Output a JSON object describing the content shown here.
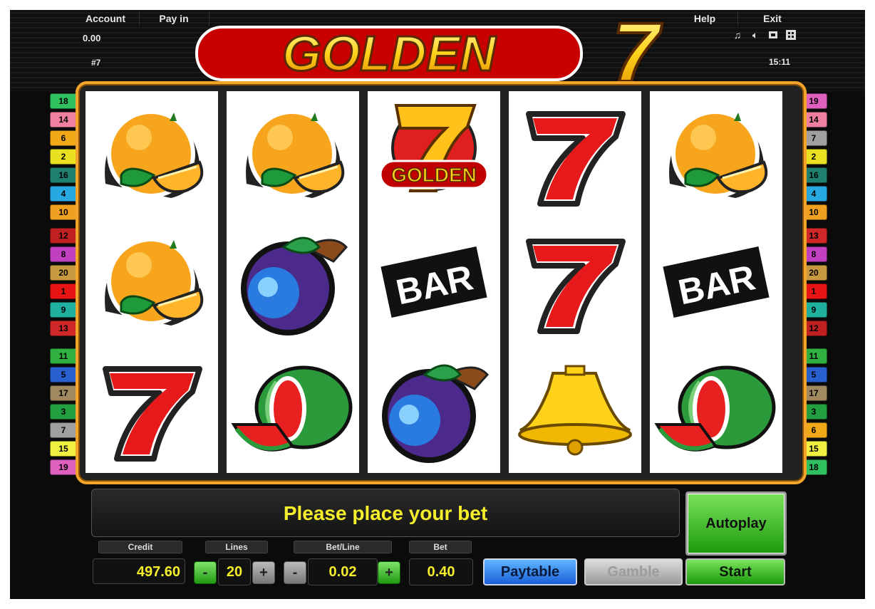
{
  "header": {
    "account_label": "Account",
    "payin_label": "Pay in",
    "help_label": "Help",
    "exit_label": "Exit",
    "account_value": "0.00",
    "session_id": "#7",
    "time": "15:11",
    "icons": [
      "music-icon",
      "sound-icon",
      "fullscreen-icon",
      "settings-icon"
    ]
  },
  "logo": {
    "text": "GOLDEN",
    "seven": "7"
  },
  "paylines": {
    "left": [
      "18",
      "14",
      "6",
      "2",
      "16",
      "4",
      "10",
      "12",
      "8",
      "20",
      "1",
      "9",
      "13",
      "11",
      "5",
      "17",
      "3",
      "7",
      "15",
      "19"
    ],
    "right": [
      "19",
      "14",
      "7",
      "2",
      "16",
      "4",
      "10",
      "13",
      "8",
      "20",
      "1",
      "9",
      "12",
      "11",
      "5",
      "17",
      "3",
      "6",
      "15",
      "18"
    ]
  },
  "line_colors": {
    "1": "#e81414",
    "2": "#e8e020",
    "3": "#22a040",
    "4": "#28a8e0",
    "5": "#2860d0",
    "6": "#f0a818",
    "7": "#a0a0a0",
    "8": "#c040c0",
    "9": "#20b0a0",
    "10": "#f0a020",
    "11": "#30b040",
    "12": "#c02020",
    "13": "#d02828",
    "14": "#f080a0",
    "15": "#f0f040",
    "16": "#208070",
    "17": "#a08860",
    "18": "#30c060",
    "19": "#e060c0",
    "20": "#c89a40"
  },
  "reels": [
    [
      "orange",
      "orange",
      "seven"
    ],
    [
      "orange",
      "plum",
      "watermelon"
    ],
    [
      "golden7",
      "bar",
      "plum"
    ],
    [
      "seven",
      "seven",
      "bell"
    ],
    [
      "orange",
      "bar",
      "watermelon"
    ]
  ],
  "message": "Please place your bet",
  "controls": {
    "credit_label": "Credit",
    "credit_value": "497.60",
    "lines_label": "Lines",
    "lines_value": "20",
    "betline_label": "Bet/Line",
    "betline_value": "0.02",
    "bet_label": "Bet",
    "bet_value": "0.40",
    "minus": "-",
    "plus": "+",
    "autoplay_label": "Autoplay",
    "paytable_label": "Paytable",
    "gamble_label": "Gamble",
    "start_label": "Start"
  }
}
